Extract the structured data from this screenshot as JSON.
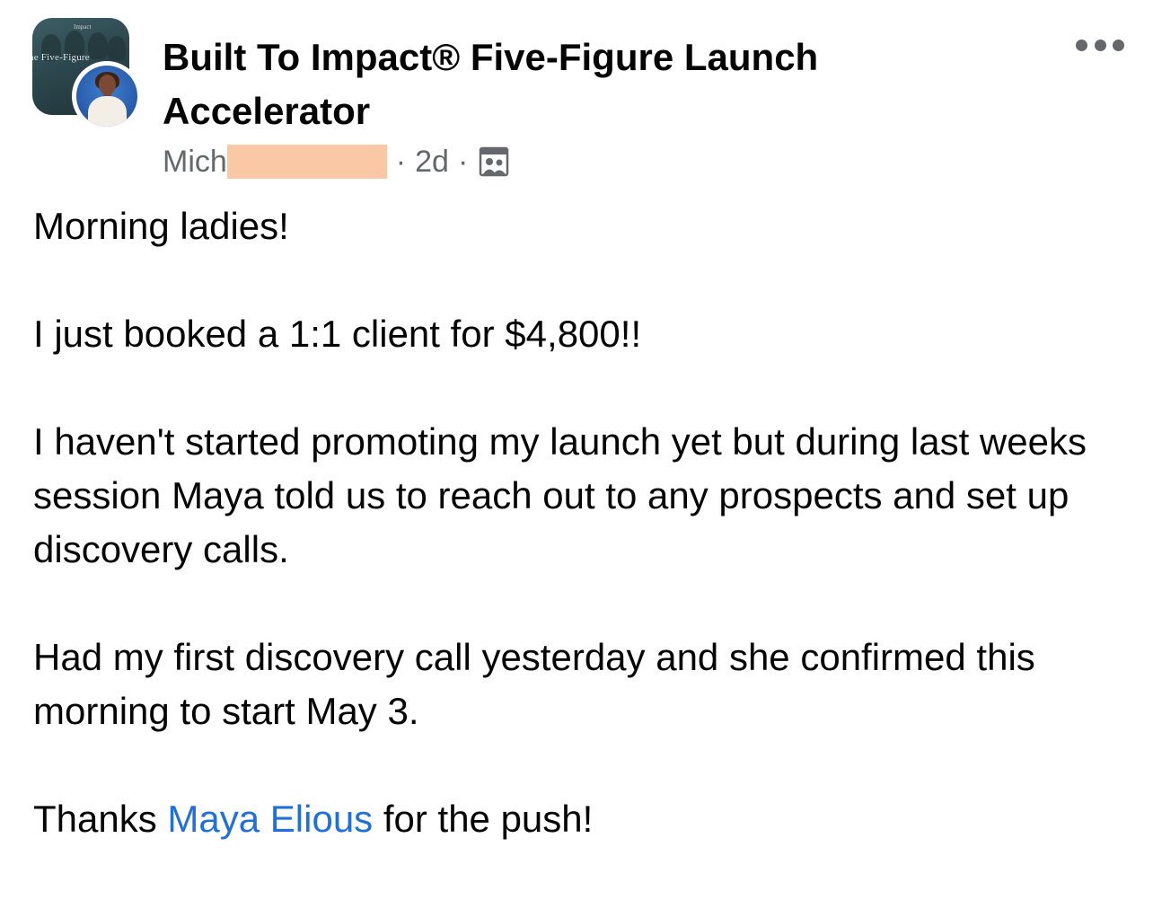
{
  "group": {
    "name": "Built To Impact® Five-Figure Launch Accelerator",
    "avatar_text": "he Five-Figure",
    "avatar_top_text": "Impact"
  },
  "meta": {
    "author_visible": "Mich",
    "time": "2d",
    "separator": "·",
    "privacy_icon": "group-members-icon"
  },
  "menu": {
    "more_icon": "more-options-icon"
  },
  "post": {
    "p1": "Morning ladies!",
    "p2": "I just booked a 1:1 client for $4,800!!",
    "p3": "I haven't started promoting my launch yet but during last weeks session Maya told us to reach out to any prospects and set up discovery calls.",
    "p4": "Had my first discovery call yesterday and she confirmed this morning to start May 3.",
    "p5_before": "Thanks ",
    "p5_mention": "Maya Elious",
    "p5_after": " for the push!"
  },
  "colors": {
    "text": "#050505",
    "secondary": "#65676b",
    "mention": "#216fdb",
    "redaction": "#fbc8a6"
  }
}
